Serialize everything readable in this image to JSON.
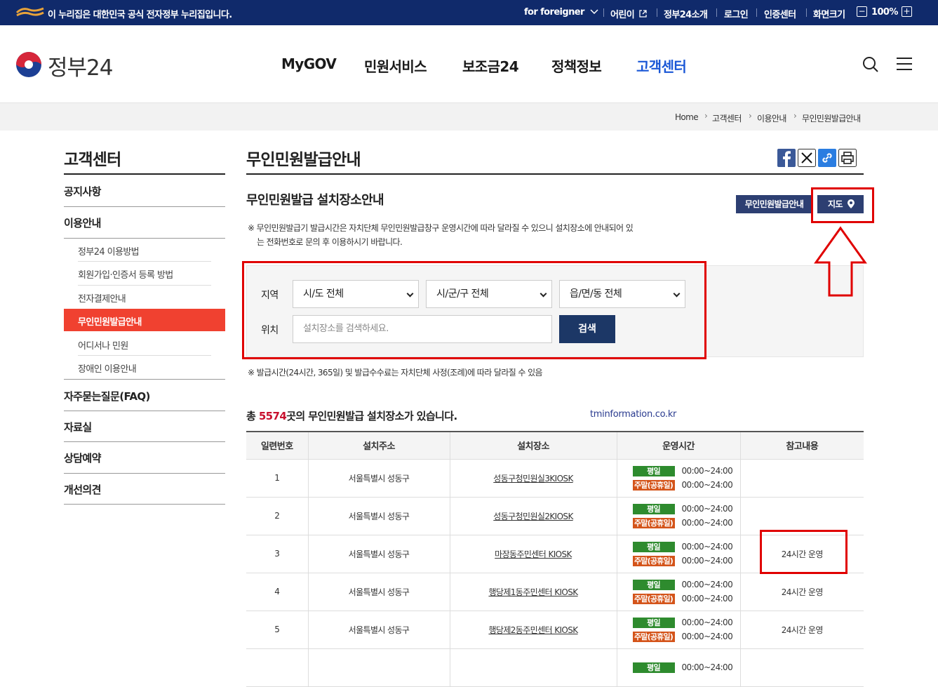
{
  "topbar": {
    "notice": "이 누리집은 대한민국 공식 전자정부 누리집입니다.",
    "foreigner": "for foreigner",
    "kids": "어린이",
    "about": "정부24소개",
    "login": "로그인",
    "cert": "인증센터",
    "zoom_label": "화면크기",
    "zoom_minus": "−",
    "zoom_value": "100%",
    "zoom_plus": "+"
  },
  "header": {
    "site_title": "정부24",
    "nav": [
      "MyGOV",
      "민원서비스",
      "보조금24",
      "정책정보",
      "고객센터"
    ],
    "active_color": "#1a57d6"
  },
  "breadcrumb": [
    "Home",
    "고객센터",
    "이용안내",
    "무인민원발급안내"
  ],
  "sidebar": {
    "title": "고객센터",
    "menu": [
      "공지사항",
      "이용안내",
      "자주묻는질문(FAQ)",
      "자료실",
      "상담예약",
      "개선의견"
    ],
    "sub": [
      "정부24 이용방법",
      "회원가입·인증서 등록 방법",
      "전자결제안내",
      "무인민원발급안내",
      "어디서나 민원",
      "장애인 이용안내"
    ],
    "active_color": "#f04130"
  },
  "main": {
    "title": "무인민원발급안내",
    "section_title": "무인민원발급 설치장소안내",
    "guide_button": "무인민원발급안내",
    "map_button": "지도",
    "note1_line1": "※ 무인민원발급기 발급시간은 자치단체 무인민원발급창구 운영시간에 따라 달라질 수 있으니 설치장소에 안내되어 있",
    "note1_line2": "는 전화번호로 문의 후 이용하시기 바랍니다.",
    "note2": "※ 발급시간(24시간, 365일) 및 발급수수료는 자치단체 사정(조례)에 따라 달라질 수 있음"
  },
  "search": {
    "region_label": "지역",
    "location_label": "위치",
    "sido": "시/도 전체",
    "sigungu": "시/군/구 전체",
    "eupmyeondong": "읍/면/동 전체",
    "placeholder": "설치장소를 검색하세요.",
    "button": "검색"
  },
  "summary": {
    "prefix": "총 ",
    "count": "5574",
    "suffix": "곳의 무인민원발급 설치장소가 있습니다.",
    "watermark": "tminformation.co.kr"
  },
  "table": {
    "headers": [
      "일련번호",
      "설치주소",
      "설치장소",
      "운영시간",
      "참고내용"
    ],
    "weekday_badge": "평일",
    "weekend_badge": "주말(공휴일)",
    "rows": [
      {
        "no": "1",
        "addr": "서울특별시 성동구",
        "place": "성동구청민원실3KIOSK",
        "weekday": "00:00~24:00",
        "weekend": "00:00~24:00",
        "note": ""
      },
      {
        "no": "2",
        "addr": "서울특별시 성동구",
        "place": "성동구청민원실2KIOSK",
        "weekday": "00:00~24:00",
        "weekend": "00:00~24:00",
        "note": ""
      },
      {
        "no": "3",
        "addr": "서울특별시 성동구",
        "place": "마장동주민센터 KIOSK",
        "weekday": "00:00~24:00",
        "weekend": "00:00~24:00",
        "note": "24시간 운영"
      },
      {
        "no": "4",
        "addr": "서울특별시 성동구",
        "place": "행당제1동주민센터 KIOSK",
        "weekday": "00:00~24:00",
        "weekend": "00:00~24:00",
        "note": "24시간 운영"
      },
      {
        "no": "5",
        "addr": "서울특별시 성동구",
        "place": "행당제2동주민센터 KIOSK",
        "weekday": "00:00~24:00",
        "weekend": "00:00~24:00",
        "note": "24시간 운영"
      }
    ]
  },
  "colors": {
    "topbar": "#102a6b",
    "button": "#2d3f72",
    "search_button": "#1c3766",
    "highlight": "#e00000",
    "weekday_badge": "#2e8b2e",
    "weekend_badge": "#d4541a"
  }
}
